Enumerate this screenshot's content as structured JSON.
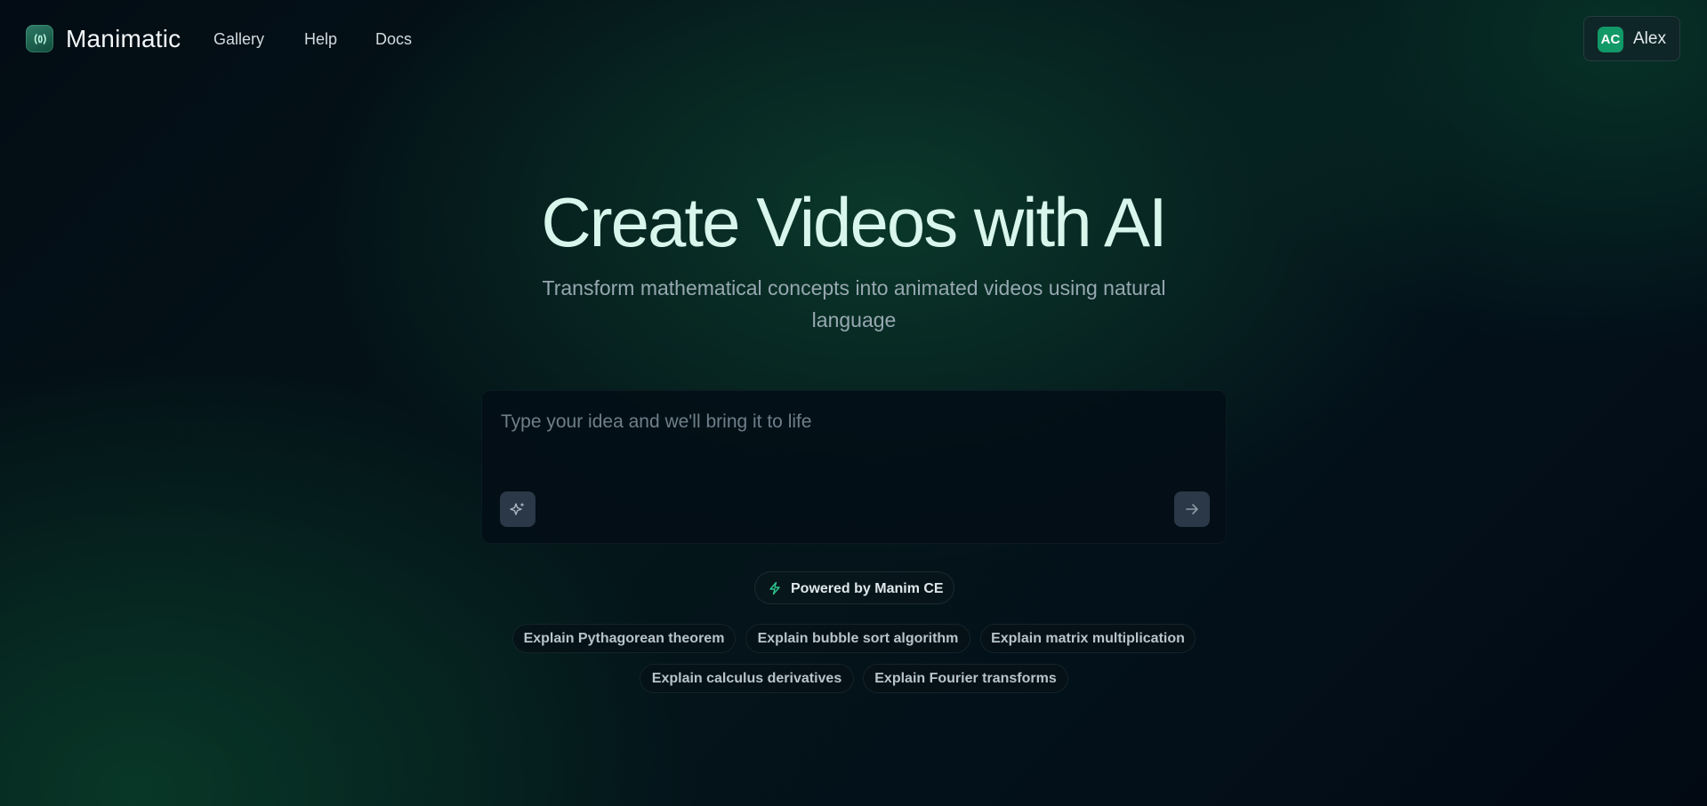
{
  "nav": {
    "brand": "Manimatic",
    "links": [
      "Gallery",
      "Help",
      "Docs"
    ],
    "user": {
      "initials": "AC",
      "name": "Alex"
    }
  },
  "hero": {
    "title": "Create Videos with AI",
    "subtitle": "Transform mathematical concepts into animated videos using natural language"
  },
  "prompt": {
    "placeholder": "Type your idea and we'll bring it to life",
    "value": ""
  },
  "badge": {
    "label": "Powered by Manim CE"
  },
  "suggestions": [
    "Explain Pythagorean theorem",
    "Explain bubble sort algorithm",
    "Explain matrix multiplication",
    "Explain calculus derivatives",
    "Explain Fourier transforms"
  ],
  "icons": {
    "logo": "wave-icon",
    "enhance": "sparkles-icon",
    "submit": "arrow-right-icon",
    "badge": "lightning-bolt-icon"
  },
  "colors": {
    "accent": "#129968",
    "title": "#d9f6ec",
    "background": "#03101a"
  }
}
